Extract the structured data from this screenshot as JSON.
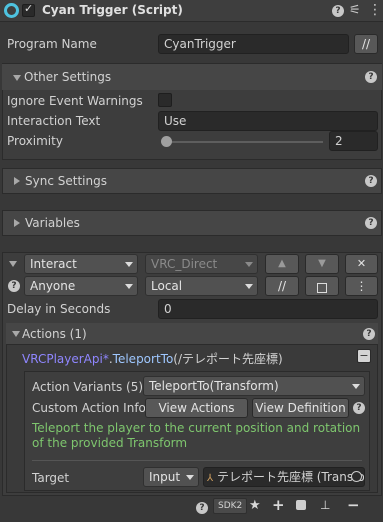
{
  "header": {
    "title": "Cyan Trigger (Script)",
    "enabled": true
  },
  "program": {
    "label": "Program Name",
    "value": "CyanTrigger",
    "comment_button": "//"
  },
  "other_settings": {
    "title": "Other Settings",
    "ignore_event_warnings_label": "Ignore Event Warnings",
    "ignore_event_warnings": false,
    "interaction_text_label": "Interaction Text",
    "interaction_text": "Use",
    "proximity_label": "Proximity",
    "proximity": "2",
    "proximity_fraction": 0.02
  },
  "sync_settings": {
    "title": "Sync Settings"
  },
  "variables": {
    "title": "Variables"
  },
  "event": {
    "type": "Interact",
    "broadcast": "VRC_Direct",
    "gate": "Anyone",
    "target": "Local",
    "comment_button": "//",
    "delay_label": "Delay in Seconds",
    "delay": "0",
    "up_arrow": "▲",
    "down_arrow": "▼",
    "close": "✕",
    "more": "⋮"
  },
  "actions": {
    "title": "Actions (1)",
    "item": {
      "owner_type": "VRCPlayerApi*",
      "method": "TeleportTo",
      "args": "(/テレポート先座標)",
      "collapse": "−"
    },
    "variants_label": "Action Variants (5)",
    "variant": "TeleportTo(Transform)",
    "custom_info_label": "Custom Action Info",
    "view_actions": "View Actions",
    "view_definition": "View Definition",
    "description": "Teleport the player to the current position and rotation of the provided Transform",
    "target_label": "Target",
    "target_mode": "Input",
    "target_value": "テレポート先座標 (Transfo"
  },
  "footer": {
    "sdk_label": "SDK2",
    "plus": "+",
    "minus": "−"
  },
  "colors": {
    "accent_link": "#8f86ff",
    "teleport_color": "#9ec7ff",
    "description_green": "#7ec66e"
  }
}
